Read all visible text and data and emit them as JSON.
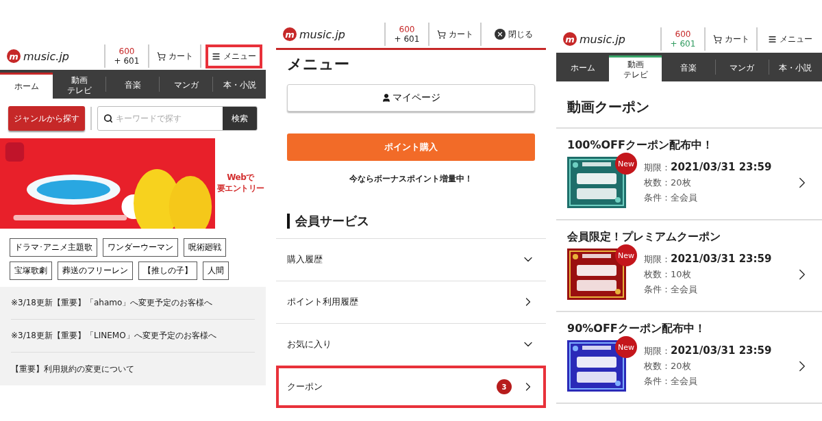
{
  "home_screen": {
    "header": {
      "logo_mark": "m",
      "logo": "music.jp",
      "points": "600",
      "bonus": "+ 601",
      "cart": "カート",
      "action": {
        "kind": "menu",
        "label": "メニュー",
        "highlighted": true
      }
    },
    "tabs": [
      {
        "label": "ホーム",
        "selected": true
      },
      {
        "lines": [
          "動画",
          "テレビ"
        ],
        "selected": false
      },
      {
        "label": "音楽",
        "selected": false
      },
      {
        "label": "マンガ",
        "selected": false
      },
      {
        "label": "本・小説",
        "selected": false
      }
    ],
    "genre_button": "ジャンルから探す",
    "search": {
      "placeholder": "キーワードで探す",
      "button": "検索"
    },
    "banner": {
      "kind": "picture",
      "side_note": [
        "Webで",
        "要エントリー"
      ]
    },
    "tags": [
      "ドラマ･アニメ主題歌",
      "ワンダーウーマン",
      "呪術廻戦",
      "宝塚歌劇",
      "葬送のフリーレン",
      "【推しの子】",
      "人間"
    ],
    "notices": [
      "※3/18更新【重要】「ahamo」へ変更予定のお客様へ",
      "※3/18更新【重要】「LINEMO」へ変更予定のお客様へ",
      "【重要】利用規約の変更について"
    ]
  },
  "menu_screen": {
    "header": {
      "logo_mark": "m",
      "logo": "music.jp",
      "points": "600",
      "bonus": "+ 601",
      "cart": "カート",
      "action": {
        "kind": "close",
        "label": "閉じる",
        "highlighted": false
      }
    },
    "title": "メニュー",
    "mypage_button": "マイページ",
    "purchase_button": "ポイント購入",
    "bonus_note": "今ならボーナスポイント増量中！",
    "section_title": "会員サービス",
    "items": [
      {
        "label": "購入履歴",
        "kind": "expand",
        "highlighted": false
      },
      {
        "label": "ポイント利用履歴",
        "kind": "link",
        "highlighted": false
      },
      {
        "label": "お気に入り",
        "kind": "expand",
        "highlighted": false
      },
      {
        "label": "クーポン",
        "kind": "link",
        "badge": "3",
        "highlighted": true
      }
    ]
  },
  "coupon_screen": {
    "header": {
      "logo_mark": "m",
      "logo": "music.jp",
      "points": "600",
      "bonus": "+ 601",
      "cart": "カート",
      "action": {
        "kind": "menu",
        "label": "メニュー",
        "highlighted": false
      }
    },
    "tabs": [
      {
        "label": "ホーム",
        "selected": false
      },
      {
        "lines": [
          "動画",
          "テレビ"
        ],
        "selected": true
      },
      {
        "label": "音楽",
        "selected": false
      },
      {
        "label": "マンガ",
        "selected": false
      },
      {
        "label": "本・小説",
        "selected": false
      }
    ],
    "title": "動画クーポン",
    "coupons": [
      {
        "title": "100%OFFクーポン配布中！",
        "badge": "New",
        "expiry_label": "期限：",
        "expiry": "2021/03/31 23:59",
        "count": "枚数：20枚",
        "condition": "条件：全会員"
      },
      {
        "title": "会員限定！プレミアムクーポン",
        "badge": "New",
        "expiry_label": "期限：",
        "expiry": "2021/03/31 23:59",
        "count": "枚数：10枚",
        "condition": "条件：全会員"
      },
      {
        "title": "90%OFFクーポン配布中！",
        "badge": "New",
        "expiry_label": "期限：",
        "expiry": "2021/03/31 23:59",
        "count": "枚数：20枚",
        "condition": "条件：全会員"
      }
    ]
  }
}
